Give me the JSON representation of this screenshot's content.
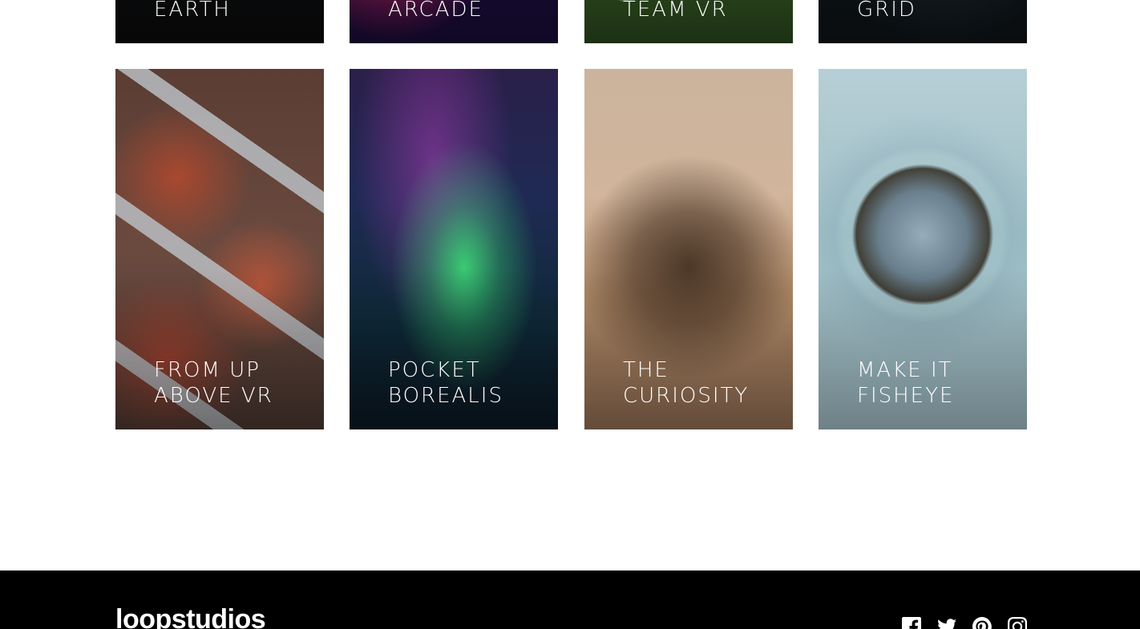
{
  "cards_top": [
    {
      "title": "EARTH",
      "name": "card-earth"
    },
    {
      "title": "ARCADE",
      "name": "card-arcade"
    },
    {
      "title": "TEAM VR",
      "name": "card-team-vr"
    },
    {
      "title": "GRID",
      "name": "card-grid"
    }
  ],
  "cards_bottom": [
    {
      "title": "FROM UP\nABOVE VR",
      "name": "card-from-up-above-vr"
    },
    {
      "title": "POCKET\nBOREALIS",
      "name": "card-pocket-borealis"
    },
    {
      "title": "THE\nCURIOSITY",
      "name": "card-the-curiosity"
    },
    {
      "title": "MAKE IT\nFISHEYE",
      "name": "card-make-it-fisheye"
    }
  ],
  "footer": {
    "brand": "loopstudios",
    "social": [
      {
        "name": "facebook-icon"
      },
      {
        "name": "twitter-icon"
      },
      {
        "name": "pinterest-icon"
      },
      {
        "name": "instagram-icon"
      }
    ]
  },
  "colors": {
    "footer_bg": "#000000",
    "text_on_dark": "#ffffff"
  }
}
